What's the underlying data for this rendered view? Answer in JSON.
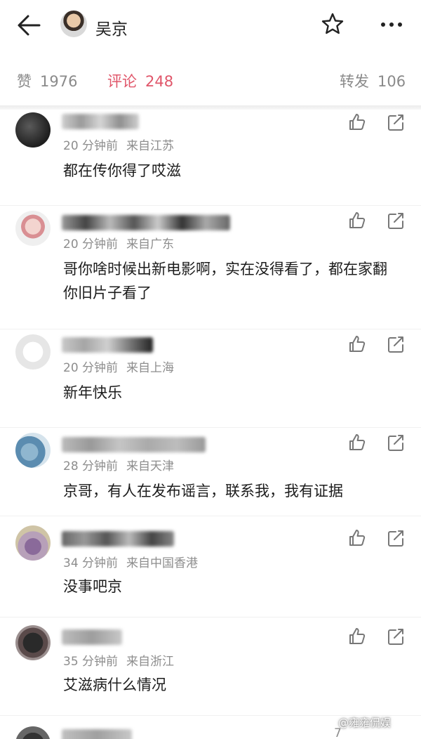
{
  "header": {
    "title": "吴京",
    "back_icon": "arrow-left-icon",
    "favorite_icon": "star-icon",
    "more_icon": "more-icon"
  },
  "tabs": [
    {
      "label": "赞",
      "count": "1976",
      "active": false
    },
    {
      "label": "评论",
      "count": "248",
      "active": true
    },
    {
      "label": "转发",
      "count": "106",
      "active": false
    }
  ],
  "colors": {
    "accent": "#e0566a",
    "meta": "#8d8d8d",
    "text": "#1c1c1c"
  },
  "comments": [
    {
      "time": "20 分钟前",
      "location": "来自江苏",
      "text": "都在传你得了哎滋"
    },
    {
      "time": "20 分钟前",
      "location": "来自广东",
      "text": "哥你啥时候出新电影啊，实在没得看了，都在家翻你旧片子看了"
    },
    {
      "time": "20 分钟前",
      "location": "来自上海",
      "text": "新年快乐"
    },
    {
      "time": "28 分钟前",
      "location": "来自天津",
      "text": "京哥，有人在发布谣言，联系我，我有证据"
    },
    {
      "time": "34 分钟前",
      "location": "来自中国香港",
      "text": "没事吧京"
    },
    {
      "time": "35 分钟前",
      "location": "来自浙江",
      "text": "艾滋病什么情况"
    }
  ],
  "partial_comment": {
    "like_count": "7"
  },
  "watermark": "@雍雍侃娱"
}
